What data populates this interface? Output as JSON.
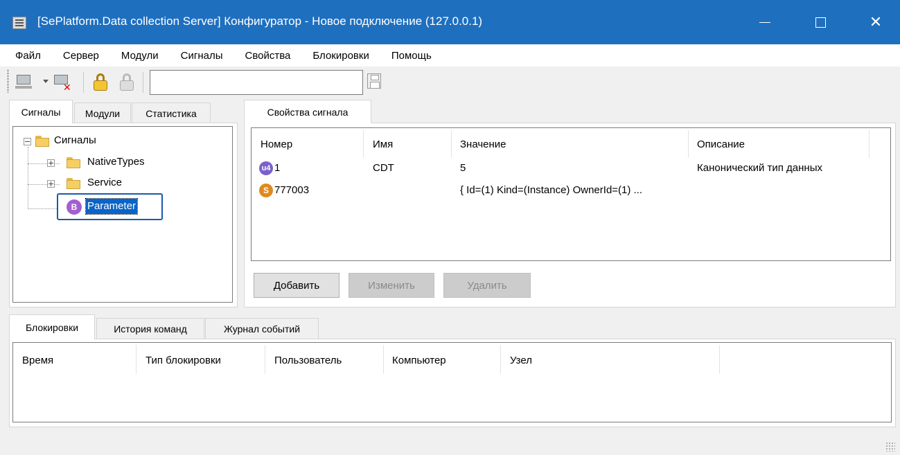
{
  "window": {
    "title": "[SePlatform.Data collection Server] Конфигуратор - Новое подключение (127.0.0.1)",
    "close_glyph": "✕"
  },
  "menu": [
    "Файл",
    "Сервер",
    "Модули",
    "Сигналы",
    "Свойства",
    "Блокировки",
    "Помощь"
  ],
  "toolbar": {
    "search_value": ""
  },
  "left_tabs": [
    "Сигналы",
    "Модули",
    "Статистика"
  ],
  "tree": {
    "root": "Сигналы",
    "children": [
      "NativeTypes",
      "Service"
    ],
    "selected": "Parameter",
    "selected_badge": "B",
    "collapse_glyph": "−",
    "expand_glyph": "+"
  },
  "right_tab": "Свойства сигнала",
  "properties": {
    "columns": [
      "Номер",
      "Имя",
      "Значение",
      "Описание"
    ],
    "rows": [
      {
        "badge": "u4",
        "number": "1",
        "name": "CDT",
        "value": "5",
        "description": "Канонический тип данных"
      },
      {
        "badge": "S",
        "number": "777003",
        "name": "",
        "value": "{ Id=(1) Kind=(Instance) OwnerId=(1) ...",
        "description": ""
      }
    ],
    "buttons": {
      "add": "Добавить",
      "edit": "Изменить",
      "delete": "Удалить"
    }
  },
  "bottom_tabs": [
    "Блокировки",
    "История команд",
    "Журнал событий"
  ],
  "locks_table": {
    "columns": [
      "Время",
      "Тип блокировки",
      "Пользователь",
      "Компьютер",
      "Узел"
    ]
  },
  "colors": {
    "titlebar": "#1f6fbf",
    "selection": "#0a64c8",
    "badge_u4": "#7a62c8",
    "badge_s": "#e08a1e",
    "badge_b": "#a35fcf"
  }
}
